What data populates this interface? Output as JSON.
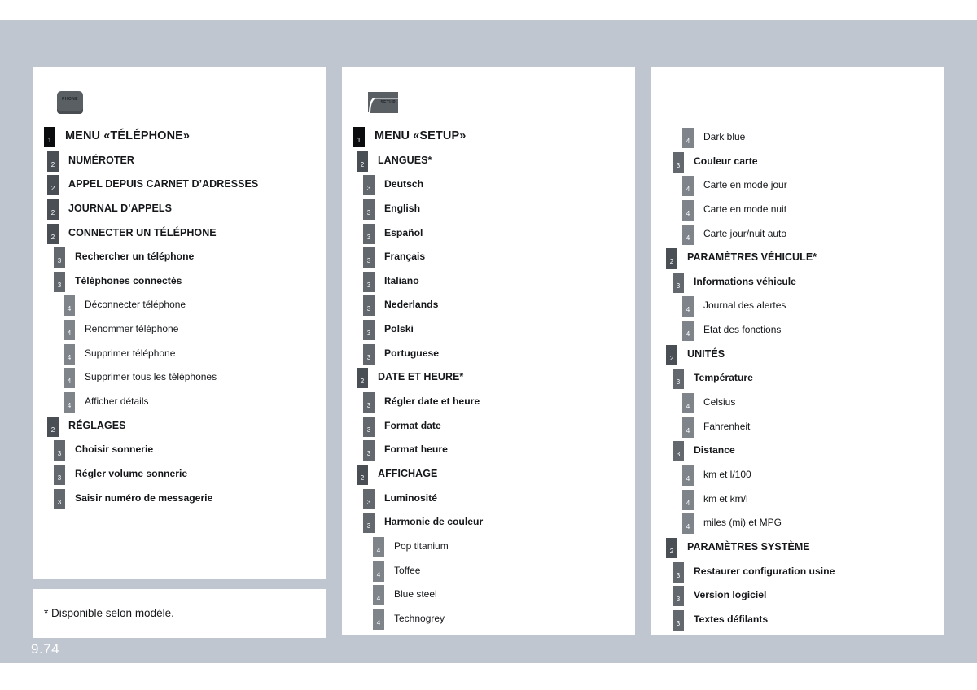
{
  "page": {
    "number": "9.74",
    "footnote": "* Disponible selon modèle.",
    "background_color": "#bfc6d0"
  },
  "columns": [
    {
      "icon": {
        "name": "phone-key-icon",
        "glyph_text": "PHONE"
      },
      "items": [
        {
          "level": 1,
          "label": "MENU «TÉLÉPHONE»"
        },
        {
          "level": 2,
          "label": "NUMÉROTER"
        },
        {
          "level": 2,
          "label": "APPEL DEPUIS CARNET D’ADRESSES"
        },
        {
          "level": 2,
          "label": "JOURNAL D’APPELS"
        },
        {
          "level": 2,
          "label": "CONNECTER UN TÉLÉPHONE"
        },
        {
          "level": 3,
          "label": "Rechercher un téléphone"
        },
        {
          "level": 3,
          "label": "Téléphones connectés"
        },
        {
          "level": 4,
          "label": "Déconnecter téléphone"
        },
        {
          "level": 4,
          "label": "Renommer téléphone"
        },
        {
          "level": 4,
          "label": "Supprimer téléphone"
        },
        {
          "level": 4,
          "label": "Supprimer tous les téléphones"
        },
        {
          "level": 4,
          "label": "Afficher détails"
        },
        {
          "level": 2,
          "label": "RÉGLAGES"
        },
        {
          "level": 3,
          "label": "Choisir sonnerie"
        },
        {
          "level": 3,
          "label": "Régler volume sonnerie"
        },
        {
          "level": 3,
          "label": "Saisir numéro de messagerie"
        }
      ]
    },
    {
      "icon": {
        "name": "setup-key-icon",
        "glyph_text": "SETUP"
      },
      "items": [
        {
          "level": 1,
          "label": "MENU «SETUP»"
        },
        {
          "level": 2,
          "label": "LANGUES*"
        },
        {
          "level": 3,
          "label": "Deutsch"
        },
        {
          "level": 3,
          "label": "English"
        },
        {
          "level": 3,
          "label": "Español"
        },
        {
          "level": 3,
          "label": "Français"
        },
        {
          "level": 3,
          "label": "Italiano"
        },
        {
          "level": 3,
          "label": "Nederlands"
        },
        {
          "level": 3,
          "label": "Polski"
        },
        {
          "level": 3,
          "label": "Portuguese"
        },
        {
          "level": 2,
          "label": "DATE ET HEURE*"
        },
        {
          "level": 3,
          "label": "Régler date et heure"
        },
        {
          "level": 3,
          "label": "Format date"
        },
        {
          "level": 3,
          "label": "Format heure"
        },
        {
          "level": 2,
          "label": "AFFICHAGE"
        },
        {
          "level": 3,
          "label": "Luminosité"
        },
        {
          "level": 3,
          "label": "Harmonie de couleur"
        },
        {
          "level": 4,
          "label": "Pop titanium"
        },
        {
          "level": 4,
          "label": "Toffee"
        },
        {
          "level": 4,
          "label": "Blue steel"
        },
        {
          "level": 4,
          "label": "Technogrey"
        }
      ]
    },
    {
      "icon": null,
      "items": [
        {
          "level": 4,
          "label": "Dark blue"
        },
        {
          "level": 3,
          "label": "Couleur carte"
        },
        {
          "level": 4,
          "label": "Carte en mode jour"
        },
        {
          "level": 4,
          "label": "Carte en mode nuit"
        },
        {
          "level": 4,
          "label": "Carte jour/nuit auto"
        },
        {
          "level": 2,
          "label": "PARAMÈTRES VÉHICULE*"
        },
        {
          "level": 3,
          "label": "Informations véhicule"
        },
        {
          "level": 4,
          "label": "Journal des alertes"
        },
        {
          "level": 4,
          "label": "Etat des fonctions"
        },
        {
          "level": 2,
          "label": "UNITÉS"
        },
        {
          "level": 3,
          "label": "Température"
        },
        {
          "level": 4,
          "label": "Celsius"
        },
        {
          "level": 4,
          "label": "Fahrenheit"
        },
        {
          "level": 3,
          "label": "Distance"
        },
        {
          "level": 4,
          "label": "km et l/100"
        },
        {
          "level": 4,
          "label": "km et km/l"
        },
        {
          "level": 4,
          "label": "miles (mi) et MPG"
        },
        {
          "level": 2,
          "label": "PARAMÈTRES SYSTÈME"
        },
        {
          "level": 3,
          "label": "Restaurer configuration usine"
        },
        {
          "level": 3,
          "label": "Version logiciel"
        },
        {
          "level": 3,
          "label": "Textes défilants"
        }
      ]
    }
  ]
}
